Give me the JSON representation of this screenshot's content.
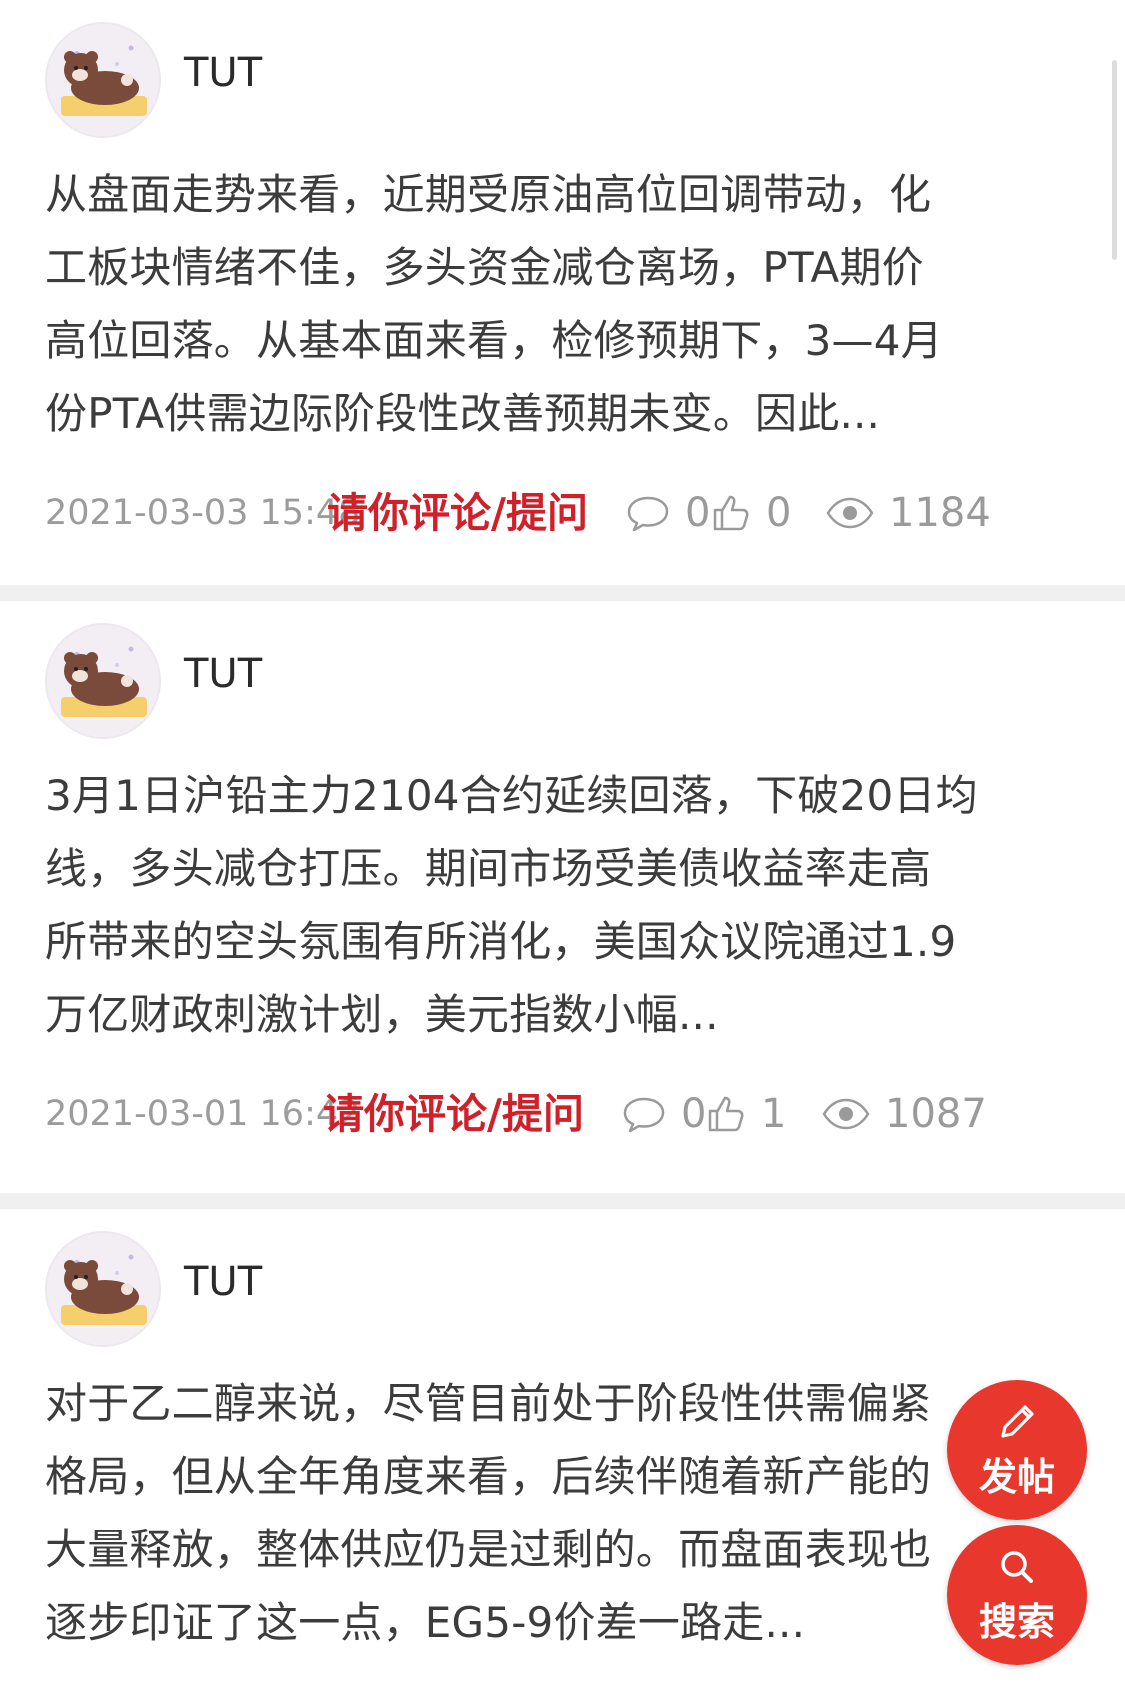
{
  "posts": [
    {
      "author": "TUT",
      "lines": [
        "从盘面走势来看，近期受原油高位回调带动，化",
        "工板块情绪不佳，多头资金减仓离场，PTA期价",
        "高位回落。从基本面来看，检修预期下，3—4月",
        "份PTA供需边际阶段性改善预期未变。因此..."
      ],
      "time": "2021-03-03 15:48",
      "comment_link": "请你评论/提问",
      "comments": "0",
      "likes": "0",
      "views": "1184"
    },
    {
      "author": "TUT",
      "lines": [
        "3月1日沪铅主力2104合约延续回落，下破20日均",
        "线，多头减仓打压。期间市场受美债收益率走高",
        "所带来的空头氛围有所消化，美国众议院通过1.9",
        "万亿财政刺激计划，美元指数小幅..."
      ],
      "time": "2021-03-01 16:42",
      "comment_link": "请你评论/提问",
      "comments": "0",
      "likes": "1",
      "views": "1087"
    },
    {
      "author": "TUT",
      "lines": [
        "对于乙二醇来说，尽管目前处于阶段性供需偏紧",
        "格局，但从全年角度来看，后续伴随着新产能的",
        "大量释放，整体供应仍是过剩的。而盘面表现也",
        "逐步印证了这一点，EG5-9价差一路走..."
      ]
    }
  ],
  "fab": {
    "post_label": "发帖",
    "search_label": "搜索"
  },
  "colors": {
    "accent": "#e8382d",
    "link": "#d0212a",
    "meta": "#9c9c9c"
  },
  "icons": [
    "avatar-bear-image",
    "comment-icon",
    "thumbs-up-icon",
    "eye-icon",
    "pencil-icon",
    "search-icon"
  ]
}
